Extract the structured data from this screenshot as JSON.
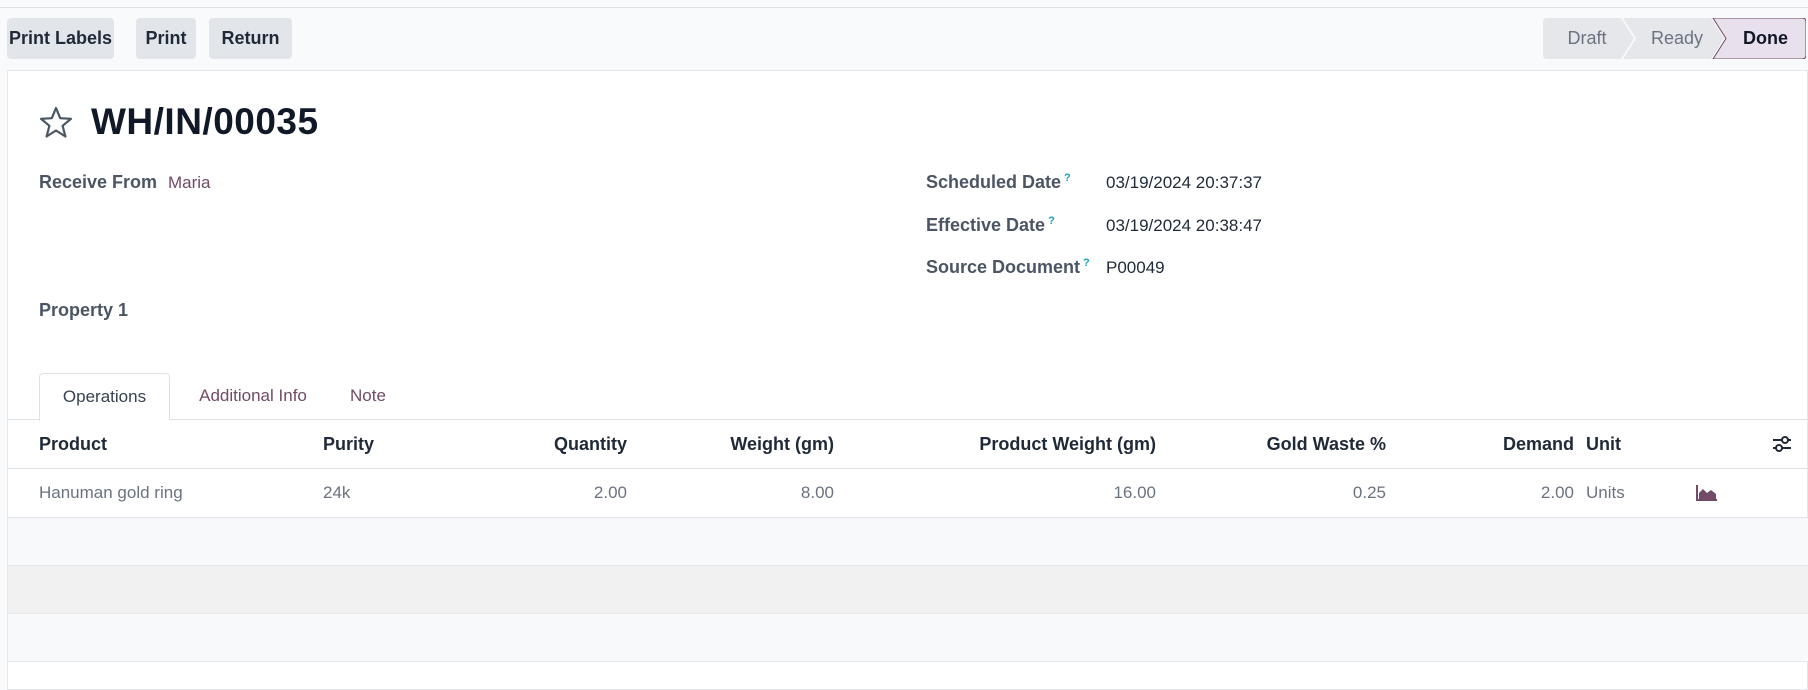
{
  "toolbar": {
    "print_labels": "Print Labels",
    "print": "Print",
    "return": "Return"
  },
  "status": {
    "stages": [
      "Draft",
      "Ready",
      "Done"
    ],
    "current": "Done"
  },
  "record": {
    "title": "WH/IN/00035",
    "receive_from_label": "Receive From",
    "receive_from_value": "Maria",
    "property_label": "Property 1",
    "scheduled_date_label": "Scheduled Date",
    "scheduled_date_value": "03/19/2024 20:37:37",
    "effective_date_label": "Effective Date",
    "effective_date_value": "03/19/2024 20:38:47",
    "source_document_label": "Source Document",
    "source_document_value": "P00049",
    "help_mark": "?"
  },
  "tabs": [
    {
      "label": "Operations",
      "active": true
    },
    {
      "label": "Additional Info",
      "active": false
    },
    {
      "label": "Note",
      "active": false
    }
  ],
  "table": {
    "columns": [
      "Product",
      "Purity",
      "Quantity",
      "Weight (gm)",
      "Product Weight (gm)",
      "Gold Waste %",
      "Demand",
      "Unit"
    ],
    "rows": [
      {
        "product": "Hanuman gold ring",
        "purity": "24k",
        "quantity": "2.00",
        "weight": "8.00",
        "product_weight": "16.00",
        "gold_waste": "0.25",
        "demand": "2.00",
        "unit": "Units"
      }
    ]
  },
  "icons": {
    "favorite": "star-icon",
    "forecast": "area-chart-icon",
    "optional_columns": "settings-sliders-icon"
  },
  "colors": {
    "accent": "#714b67",
    "done_stage_bg": "#e9e0ee",
    "help": "#17a2b8"
  }
}
